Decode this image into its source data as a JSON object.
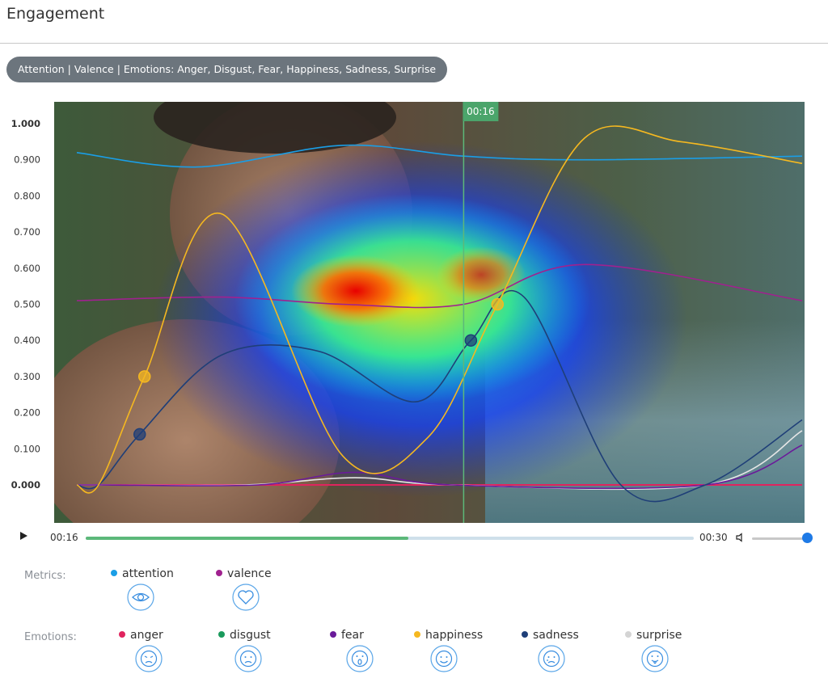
{
  "header": {
    "title": "Engagement"
  },
  "filter_pill": {
    "label": "Attention | Valence | Emotions: Anger, Disgust, Fear, Happiness, Sadness, Surprise"
  },
  "player": {
    "current_time": "00:16",
    "end_time": "00:30",
    "progress_fraction": 0.53,
    "volume_fraction": 1.0,
    "play_icon": "play-icon",
    "volume_icon": "volume-icon"
  },
  "chart_data": {
    "type": "line",
    "y_ticks": [
      "1.000",
      "0.900",
      "0.800",
      "0.700",
      "0.600",
      "0.500",
      "0.400",
      "0.300",
      "0.200",
      "0.100",
      "0.000"
    ],
    "ylim": [
      0,
      1
    ],
    "xlim": [
      0,
      30
    ],
    "cursor": {
      "time": 16,
      "label": "00:16"
    },
    "background": "video frame with attention heatmap overlay",
    "series": [
      {
        "name": "attention",
        "color": "#1a9ee6",
        "x": [
          0,
          5,
          11,
          16,
          21,
          30
        ],
        "values": [
          0.92,
          0.88,
          0.94,
          0.91,
          0.9,
          0.91
        ]
      },
      {
        "name": "valence",
        "color": "#a0218f",
        "x": [
          0,
          6,
          11,
          16,
          21,
          30
        ],
        "values": [
          0.51,
          0.52,
          0.5,
          0.5,
          0.61,
          0.51
        ]
      },
      {
        "name": "anger",
        "color": "#e0245e",
        "x": [
          0,
          30
        ],
        "values": [
          0.0,
          0.0
        ]
      },
      {
        "name": "disgust",
        "color": "#1a9a5c",
        "x": [
          0,
          30
        ],
        "values": [
          0.0,
          0.0
        ]
      },
      {
        "name": "fear",
        "color": "#6a1b9a",
        "x": [
          0,
          0.9,
          7.5,
          11.5,
          15.5,
          26,
          30
        ],
        "values": [
          0.0,
          0.0,
          0.0,
          0.035,
          0.0,
          0.0,
          0.11
        ]
      },
      {
        "name": "happiness",
        "color": "#f5b820",
        "x": [
          0,
          0.9,
          2.8,
          6,
          11,
          14.5,
          17.4,
          21,
          25,
          30
        ],
        "values": [
          0.0,
          0.0,
          0.3,
          0.75,
          0.08,
          0.13,
          0.5,
          0.96,
          0.95,
          0.89
        ]
      },
      {
        "name": "sadness",
        "color": "#1f3f78",
        "x": [
          0,
          0.9,
          2.6,
          6,
          10,
          14,
          16.3,
          18.5,
          22.5,
          26,
          30
        ],
        "values": [
          0.0,
          0.0,
          0.14,
          0.36,
          0.37,
          0.23,
          0.4,
          0.52,
          0.0,
          0.0,
          0.18
        ]
      },
      {
        "name": "surprise",
        "color": "#e6e6e6",
        "x": [
          0,
          0.9,
          7,
          11.5,
          15.5,
          26,
          30
        ],
        "values": [
          0.0,
          0.0,
          0.0,
          0.02,
          0.0,
          0.0,
          0.15
        ]
      }
    ]
  },
  "legend": {
    "metrics_label": "Metrics:",
    "emotions_label": "Emotions:",
    "metrics": [
      {
        "name": "attention",
        "color": "#1a9ee6",
        "icon": "eye-icon"
      },
      {
        "name": "valence",
        "color": "#a0218f",
        "icon": "heart-icon"
      }
    ],
    "emotions": [
      {
        "name": "anger",
        "color": "#e0245e",
        "icon": "angry-face-icon"
      },
      {
        "name": "disgust",
        "color": "#1a9a5c",
        "icon": "disgusted-face-icon"
      },
      {
        "name": "fear",
        "color": "#6a1b9a",
        "icon": "fearful-face-icon"
      },
      {
        "name": "happiness",
        "color": "#f5b820",
        "icon": "smiling-face-icon"
      },
      {
        "name": "sadness",
        "color": "#1f3f78",
        "icon": "sad-face-icon"
      },
      {
        "name": "surprise",
        "color": "#d4d4d4",
        "icon": "surprised-face-icon"
      }
    ]
  }
}
